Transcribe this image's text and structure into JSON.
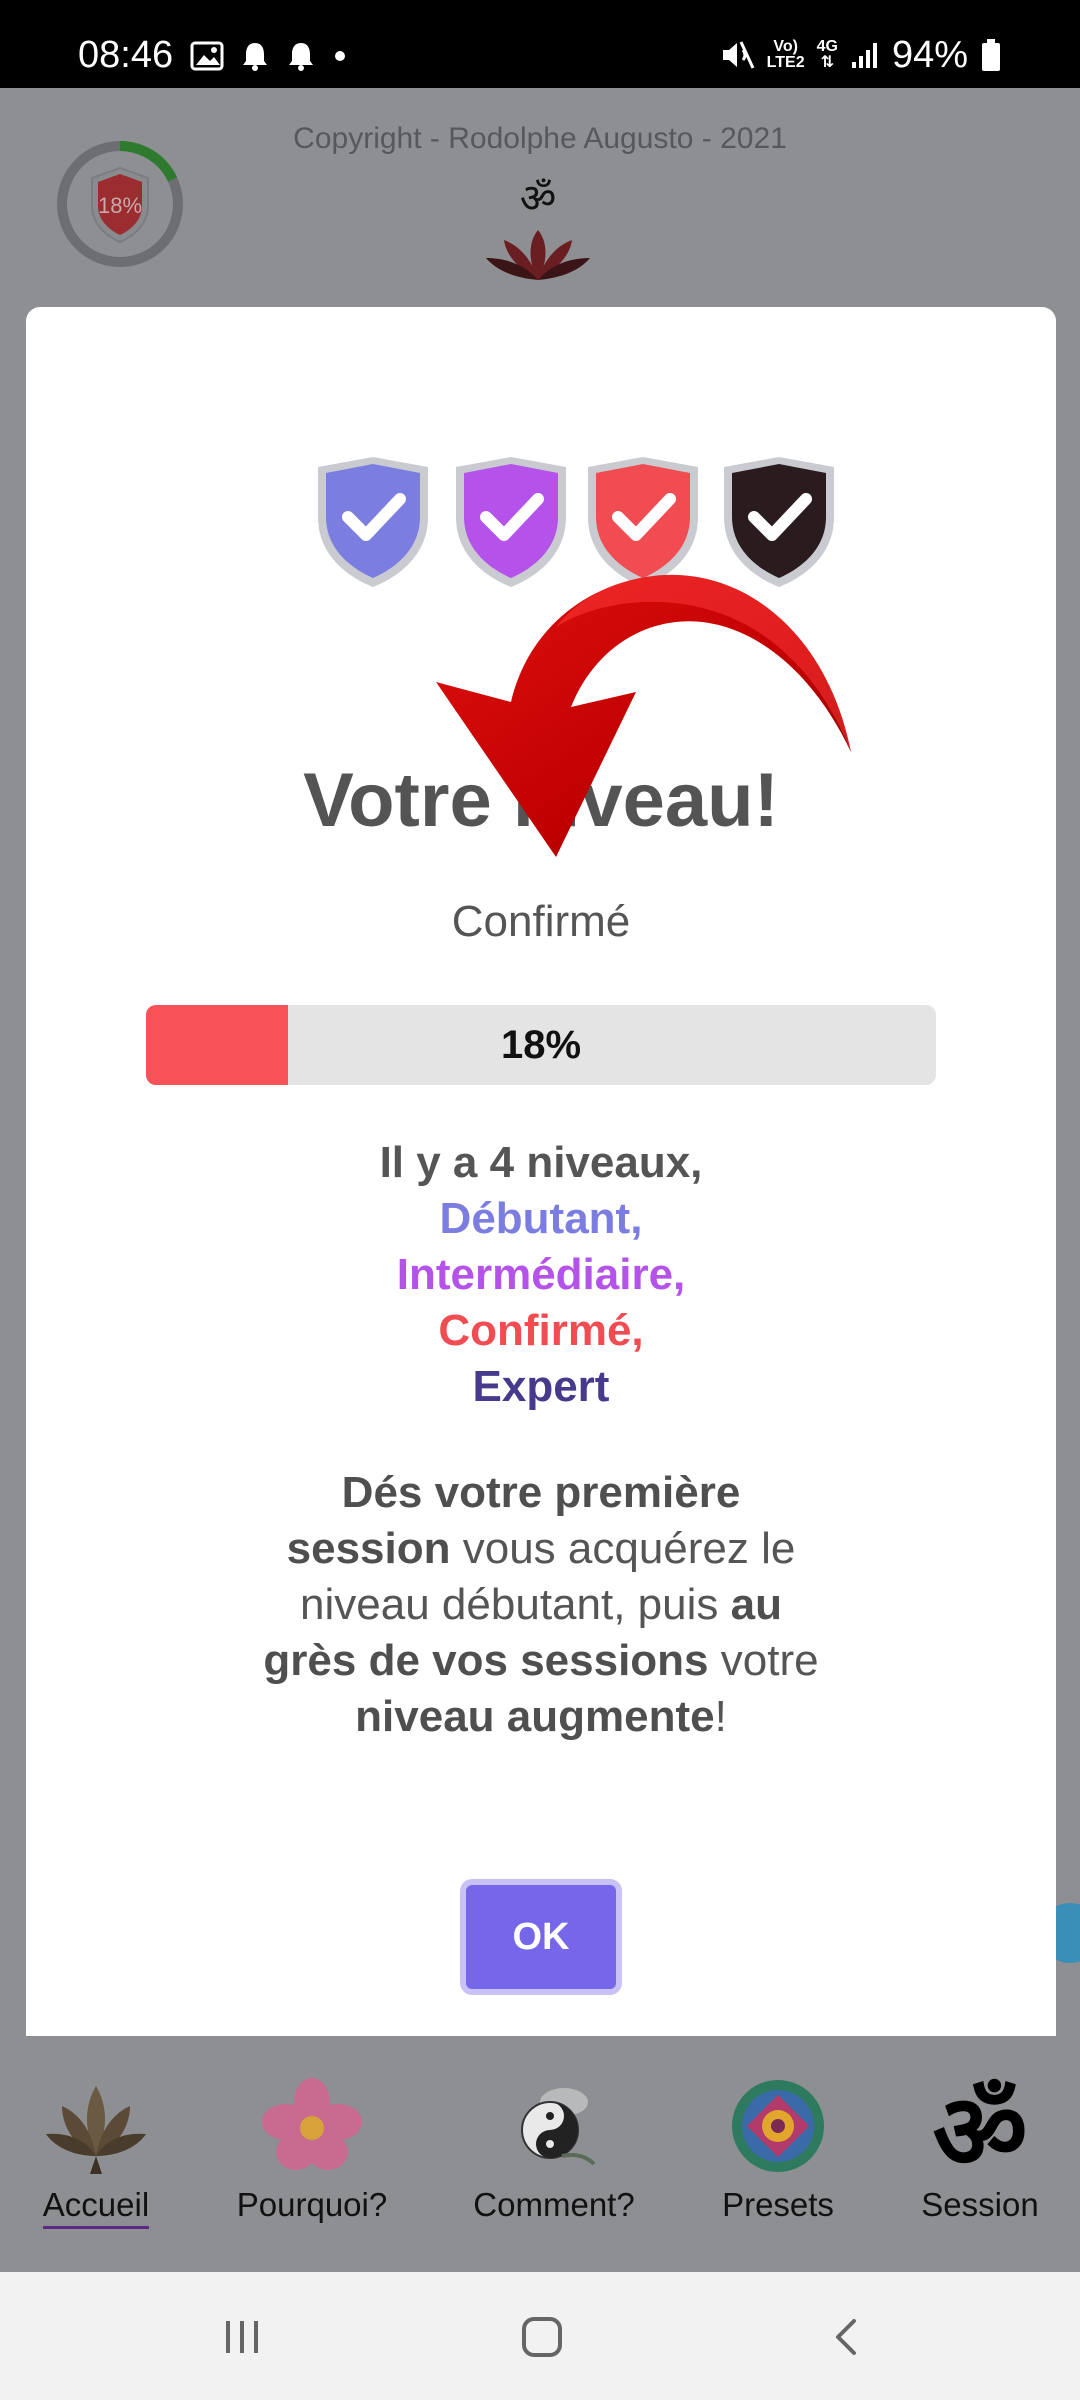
{
  "status_bar": {
    "time": "08:46",
    "net_top": "Vo)",
    "net_bottom": "LTE2",
    "net_4g": "4G",
    "battery": "94%"
  },
  "background": {
    "copyright": "Copyright - Rodolphe Augusto - 2021",
    "level_badge_percent": "18%",
    "level_progress": 0.18
  },
  "modal": {
    "title": "Votre niveau!",
    "level_name": "Confirmé",
    "progress_label": "18%",
    "progress_value": 0.18,
    "levels_intro": "Il y a 4 niveaux,",
    "levels": [
      {
        "label": "Débutant,",
        "color": "#7b7ee0"
      },
      {
        "label": "Intermédiaire,",
        "color": "#b452ea"
      },
      {
        "label": "Confirmé,",
        "color": "#f14c51"
      },
      {
        "label": "Expert",
        "color": "#453a8c"
      }
    ],
    "description": {
      "p1_bold": "Dés votre première session",
      "p2": " vous acquérez le niveau débutant, puis ",
      "p3_bold": "au grès de vos sessions",
      "p4": " votre ",
      "p5_bold": "niveau augmente",
      "p6": "!"
    },
    "ok_label": "OK"
  },
  "bottom_nav": {
    "items": [
      {
        "label": "Accueil",
        "icon": "lotus-icon",
        "active": true
      },
      {
        "label": "Pourquoi?",
        "icon": "flower-icon",
        "active": false
      },
      {
        "label": "Comment?",
        "icon": "yin-yang-icon",
        "active": false
      },
      {
        "label": "Presets",
        "icon": "mandala-icon",
        "active": false
      },
      {
        "label": "Session",
        "icon": "om-icon",
        "active": false
      }
    ]
  },
  "system_nav": {
    "recents": "recents",
    "home": "home",
    "back": "back"
  }
}
